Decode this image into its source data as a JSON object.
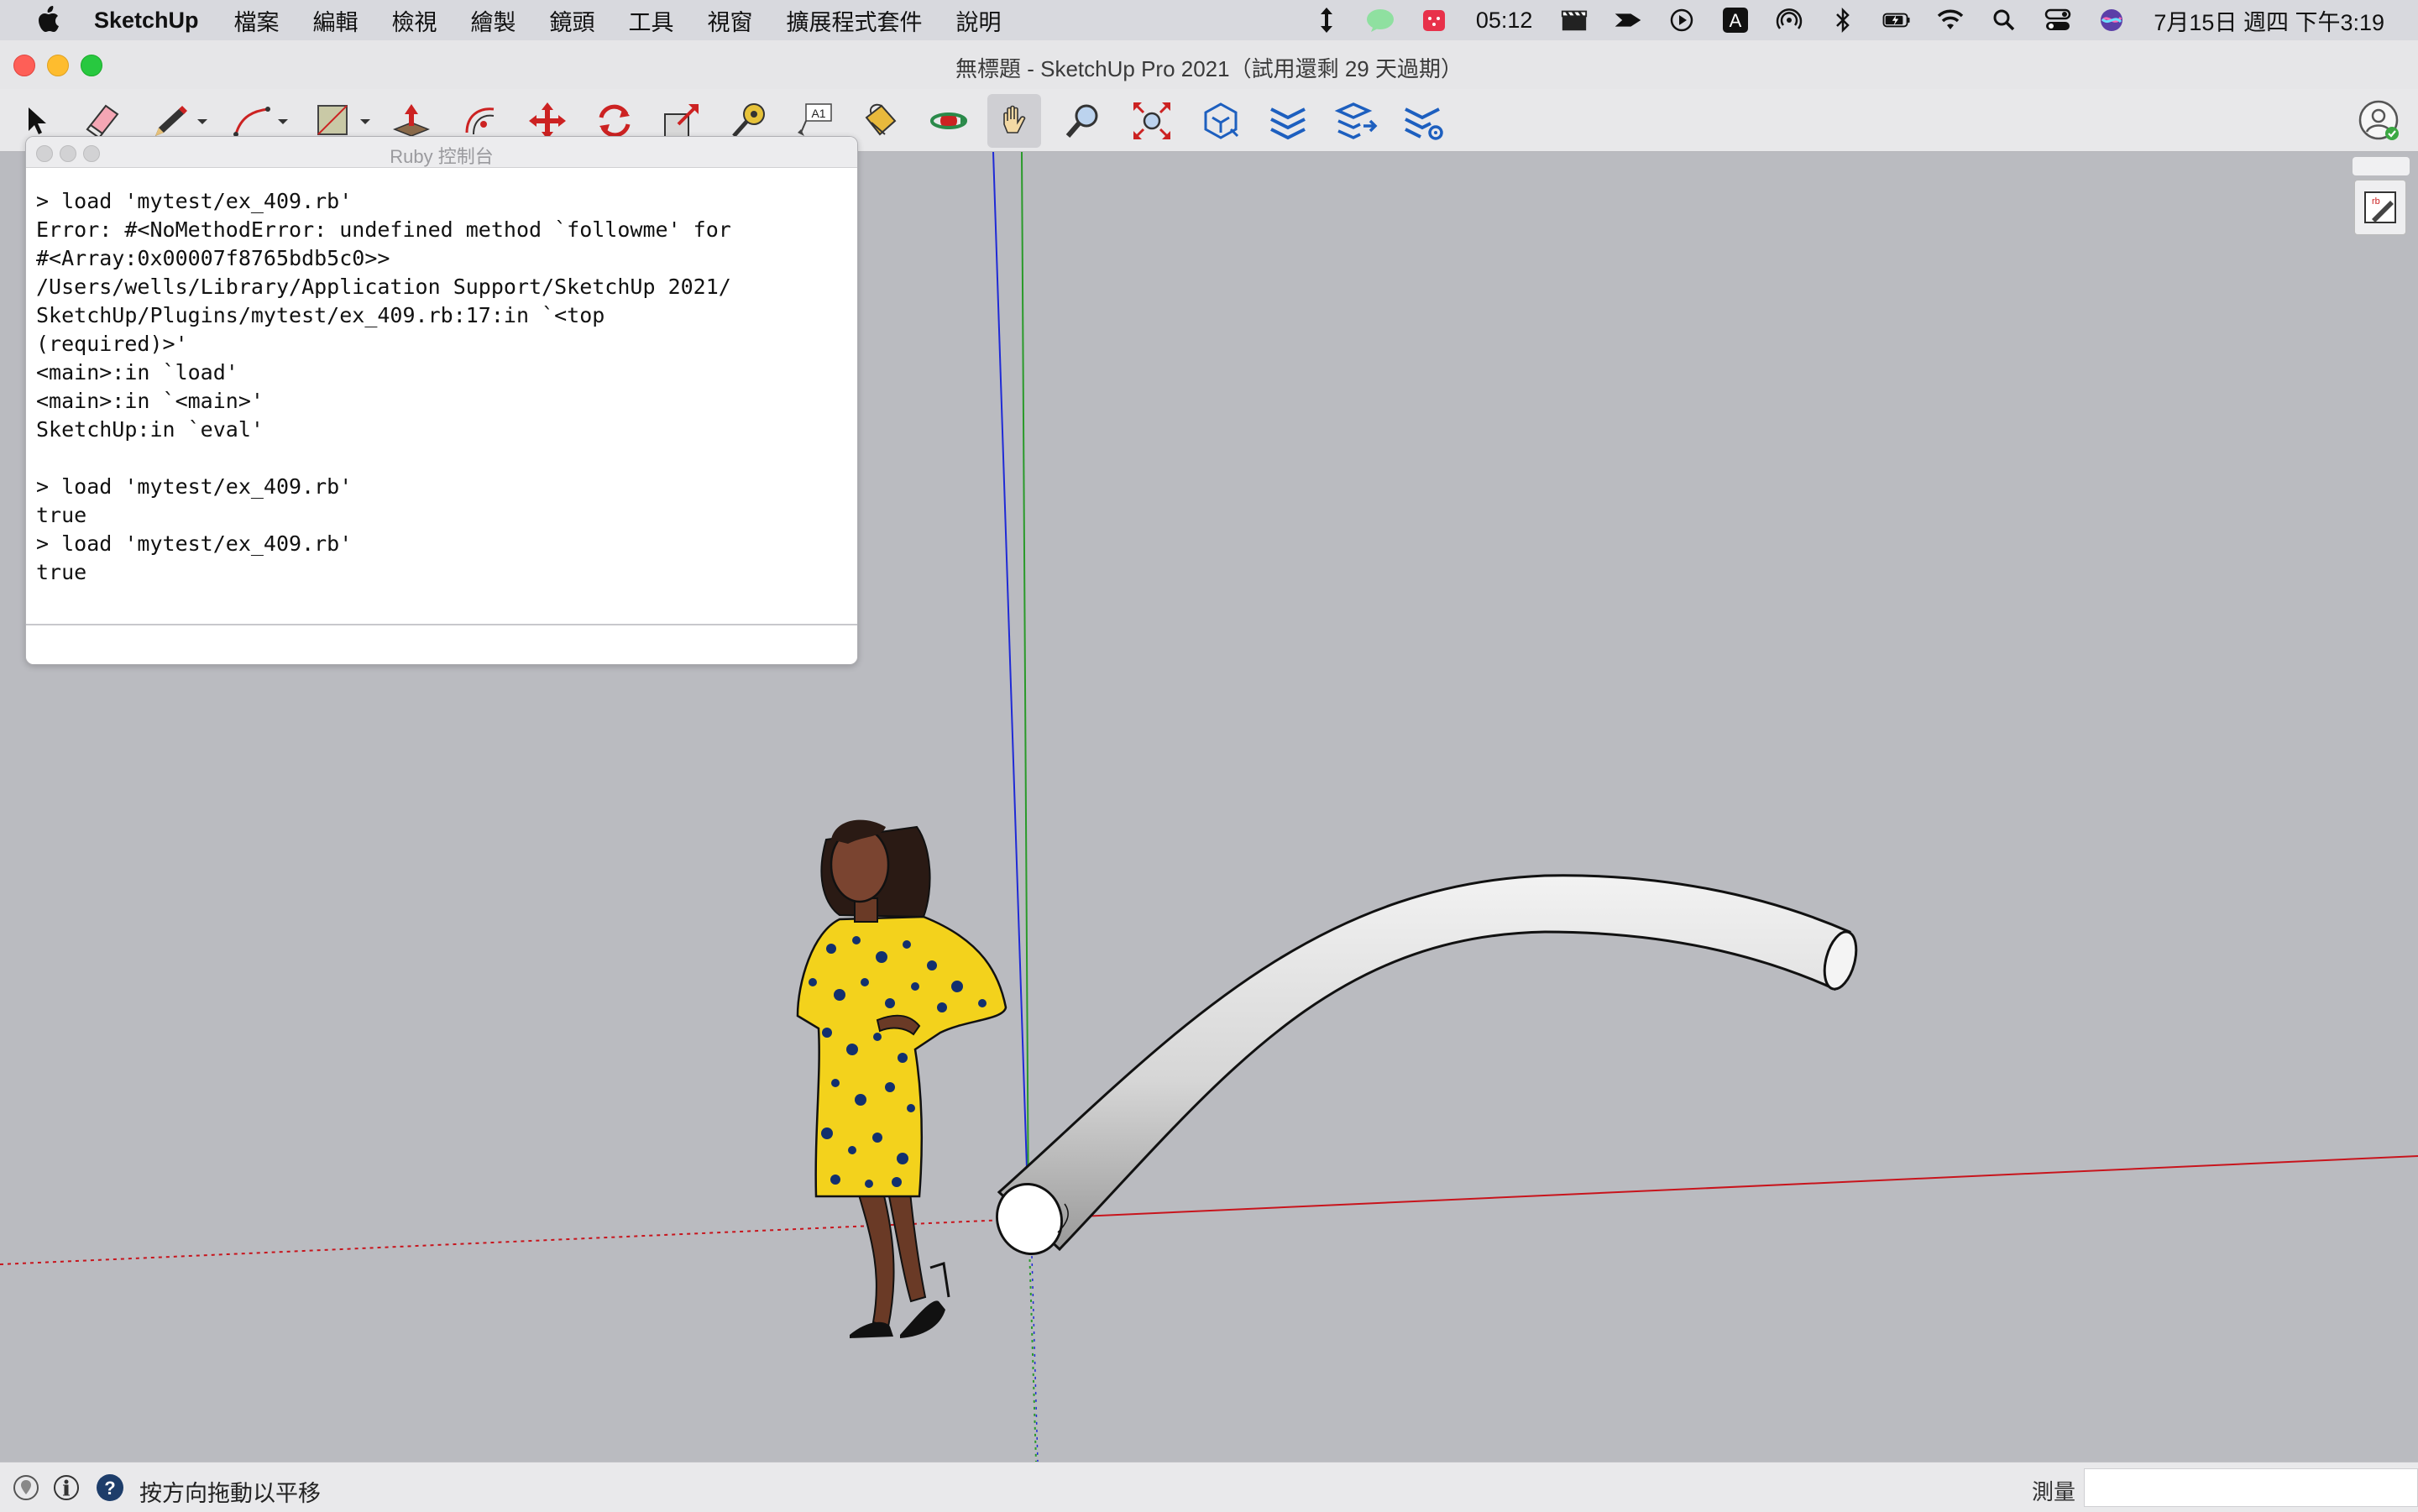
{
  "menubar": {
    "app_name": "SketchUp",
    "menus": [
      "檔案",
      "編輯",
      "檢視",
      "繪製",
      "鏡頭",
      "工具",
      "視窗",
      "擴展程式套件",
      "說明"
    ],
    "clock_widget": "05:12",
    "datetime": "7月15日 週四 下午3:19",
    "input_method": "A",
    "status_icons": [
      "scroll-arrows-icon",
      "line-icon",
      "calendar-icon",
      "clapper-icon",
      "arrow-app-icon",
      "play-circle-icon",
      "input-method-icon",
      "airdrop-icon",
      "bluetooth-icon",
      "battery-icon",
      "wifi-icon",
      "spotlight-icon",
      "control-center-icon",
      "siri-icon"
    ]
  },
  "window": {
    "title": "無標題 - SketchUp Pro 2021（試用還剩 29 天過期）"
  },
  "toolbar": {
    "tools": [
      "select-tool-icon",
      "eraser-tool-icon",
      "pencil-tool-icon",
      "arc-tool-icon",
      "rectangle-tool-icon",
      "push-pull-tool-icon",
      "offset-tool-icon",
      "move-tool-icon",
      "rotate-tool-icon",
      "scale-tool-icon",
      "tape-measure-tool-icon",
      "text-tool-icon",
      "paint-bucket-tool-icon",
      "orbit-tool-icon",
      "pan-tool-icon",
      "zoom-tool-icon",
      "zoom-extents-tool-icon",
      "warehouse-icon",
      "extension-warehouse-icon",
      "send-to-layout-icon",
      "extension-manager-icon"
    ],
    "active_tool": "pan-tool-icon",
    "text_tool_label": "A1"
  },
  "ruby_console": {
    "title": "Ruby 控制台",
    "output": "> load 'mytest/ex_409.rb'\nError: #<NoMethodError: undefined method `followme' for\n#<Array:0x00007f8765bdb5c0>>\n/Users/wells/Library/Application Support/SketchUp 2021/\nSketchUp/Plugins/mytest/ex_409.rb:17:in `<top\n(required)>'\n<main>:in `load'\n<main>:in `<main>'\nSketchUp:in `eval'\n\n> load 'mytest/ex_409.rb'\ntrue\n> load 'mytest/ex_409.rb'\ntrue",
    "input_value": ""
  },
  "status_bar": {
    "message": "按方向拖動以平移",
    "measurements_label": "測量",
    "measurements_value": ""
  },
  "colors": {
    "viewport_bg": "#babbc0",
    "axis_red": "#c8141c",
    "axis_green": "#2a9a2a",
    "axis_blue": "#1f2ad6"
  }
}
